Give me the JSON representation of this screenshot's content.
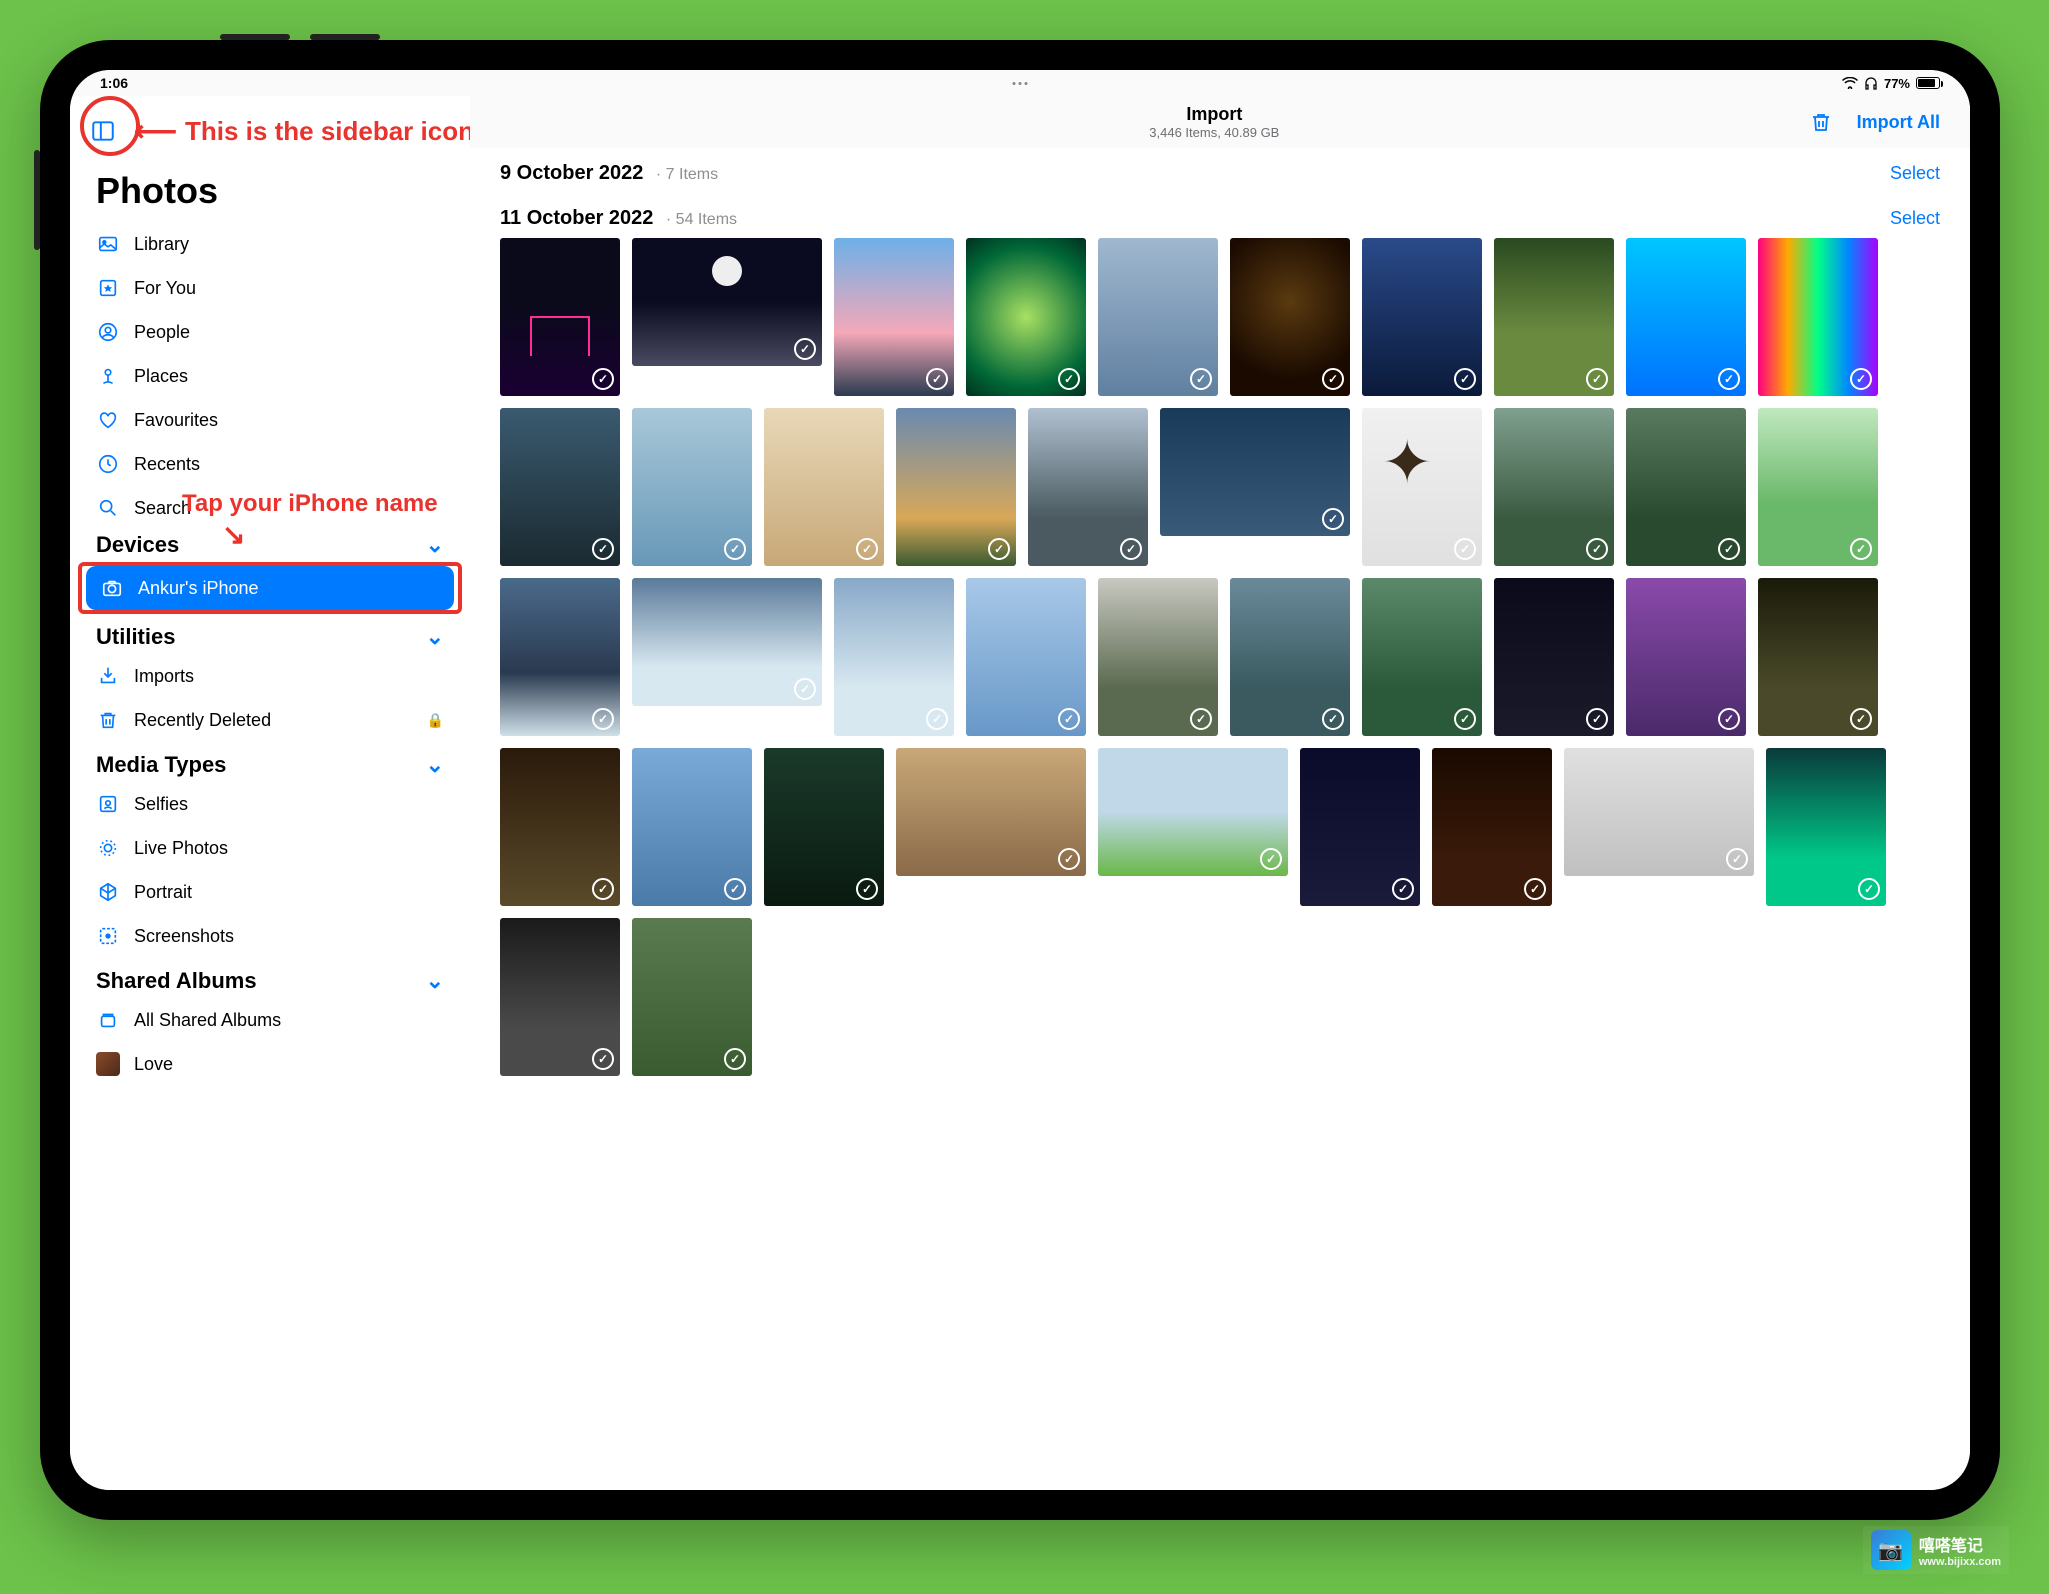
{
  "status": {
    "time": "1:06",
    "battery": "77%"
  },
  "sidebar": {
    "toggle_annotation": "This is the sidebar icon",
    "title": "Photos",
    "items": [
      {
        "icon": "library",
        "label": "Library"
      },
      {
        "icon": "foryou",
        "label": "For You"
      },
      {
        "icon": "people",
        "label": "People"
      },
      {
        "icon": "places",
        "label": "Places"
      },
      {
        "icon": "heart",
        "label": "Favourites"
      },
      {
        "icon": "clock",
        "label": "Recents"
      },
      {
        "icon": "search",
        "label": "Search"
      }
    ],
    "devices_header": "Devices",
    "iphone_annotation": "Tap your iPhone name",
    "device_item": "Ankur's iPhone",
    "utilities_header": "Utilities",
    "utilities": [
      {
        "icon": "imports",
        "label": "Imports"
      },
      {
        "icon": "trash",
        "label": "Recently Deleted",
        "locked": true
      }
    ],
    "media_header": "Media Types",
    "media": [
      {
        "icon": "selfie",
        "label": "Selfies"
      },
      {
        "icon": "live",
        "label": "Live Photos"
      },
      {
        "icon": "portrait",
        "label": "Portrait"
      },
      {
        "icon": "screenshot",
        "label": "Screenshots"
      }
    ],
    "shared_header": "Shared Albums",
    "shared": [
      {
        "icon": "shared",
        "label": "All Shared Albums"
      },
      {
        "icon": "love",
        "label": "Love"
      }
    ]
  },
  "topbar": {
    "title": "Import",
    "subtitle": "3,446 Items, 40.89 GB",
    "import_all": "Import All"
  },
  "sections": [
    {
      "date": "9 October 2022",
      "count": "7 Items",
      "select": "Select"
    },
    {
      "date": "11 October 2022",
      "count": "54 Items",
      "select": "Select"
    }
  ],
  "watermark": {
    "name": "嘻嗒笔记",
    "url": "www.bijixx.com"
  },
  "thumbs": {
    "row1": [
      {
        "o": "port",
        "bg": "linear-gradient(180deg,#0a0a1a 40%,#1a0033)",
        "accent": "#ff2d95"
      },
      {
        "o": "land",
        "bg": "linear-gradient(180deg,#0a0a20 50%,#4a4a60)",
        "moon": true
      },
      {
        "o": "port",
        "bg": "linear-gradient(180deg,#6db0e8,#f4a8b8 60%,#2a3a50)"
      },
      {
        "o": "port",
        "bg": "radial-gradient(circle at 50% 50%,#a8e063,#006837 70%,#003020)"
      },
      {
        "o": "port",
        "bg": "linear-gradient(180deg,#a0b8d0,#6080a0)"
      },
      {
        "o": "port",
        "bg": "radial-gradient(circle at 50% 40%,#5a3a10,#1a0a00 70%)"
      },
      {
        "o": "port",
        "bg": "linear-gradient(180deg,#2a4a8a,#0a1a3a)"
      }
    ],
    "row2": [
      {
        "o": "port",
        "bg": "linear-gradient(180deg,#2a4a20,#6a8a40 60%)"
      },
      {
        "o": "port",
        "bg": "linear-gradient(180deg,#00c6ff,#0072ff)"
      },
      {
        "o": "port",
        "bg": "linear-gradient(90deg,#ff0080,#ffaa00,#00ff88,#0088ff,#aa00ff)"
      },
      {
        "o": "port",
        "bg": "linear-gradient(180deg,#3a5a70,#1a2a30)"
      },
      {
        "o": "port",
        "bg": "linear-gradient(180deg,#a8c8d8,#6898b8)"
      },
      {
        "o": "port",
        "bg": "linear-gradient(180deg,#e8d8b8,#c8a878)"
      }
    ],
    "row3": [
      {
        "o": "port",
        "bg": "linear-gradient(180deg,#6a8ab0,#d8a858 70%,#3a5a30)"
      },
      {
        "o": "port",
        "bg": "linear-gradient(180deg,#b0c0d0,#4a5a60 70%)"
      },
      {
        "o": "land",
        "bg": "linear-gradient(180deg,#1a3a5a,#3a5a7a)"
      },
      {
        "o": "port",
        "bg": "linear-gradient(180deg,#f0f0f0,#e0e0e0)",
        "branch": true
      },
      {
        "o": "port",
        "bg": "linear-gradient(180deg,#80a090,#3a5a40 70%)"
      },
      {
        "o": "port",
        "bg": "linear-gradient(180deg,#5a7a60,#2a4a30 70%)"
      },
      {
        "o": "port",
        "bg": "linear-gradient(180deg,#c0e8c0,#6ab86a 60%)"
      }
    ],
    "row4": [
      {
        "o": "port",
        "bg": "linear-gradient(180deg,#4a6a8a,#2a3a50 60%,#d0e0e8)"
      },
      {
        "o": "land",
        "bg": "linear-gradient(180deg,#5a7a9a,#d8e8f0 70%)"
      },
      {
        "o": "port",
        "bg": "linear-gradient(180deg,#88a8c8,#d8e8f0 70%)"
      },
      {
        "o": "port",
        "bg": "linear-gradient(180deg,#a8c8e8,#6898c8)"
      },
      {
        "o": "port",
        "bg": "linear-gradient(180deg,#c8c8c0,#5a6a50 70%)"
      },
      {
        "o": "port",
        "bg": "linear-gradient(180deg,#6a8a9a,#3a5a60 70%)"
      },
      {
        "o": "port",
        "bg": "linear-gradient(180deg,#5a8a6a,#2a5a3a 70%)"
      }
    ],
    "row5": [
      {
        "o": "port",
        "bg": "linear-gradient(180deg,#0a0a1a,#1a1a2a)"
      },
      {
        "o": "port",
        "bg": "linear-gradient(180deg,#8a4aaa,#4a2a6a)"
      },
      {
        "o": "port",
        "bg": "linear-gradient(180deg,#1a1a0a,#4a4a2a 70%)"
      },
      {
        "o": "port",
        "bg": "linear-gradient(180deg,#2a1a0a,#5a4a2a)"
      },
      {
        "o": "port",
        "bg": "linear-gradient(180deg,#7aaad8,#4a7aa8)"
      },
      {
        "o": "port",
        "bg": "linear-gradient(180deg,#1a3a2a,#0a1a10)"
      },
      {
        "o": "land",
        "bg": "linear-gradient(180deg,#c8a878,#8a6a48)"
      }
    ],
    "row6": [
      {
        "o": "land",
        "bg": "linear-gradient(180deg,#c0d8e8 50%,#6ab848)"
      },
      {
        "o": "port",
        "bg": "linear-gradient(180deg,#0a0a2a,#1a1a3a)"
      },
      {
        "o": "port",
        "bg": "linear-gradient(180deg,#1a0a00,#3a1a0a 70%)"
      },
      {
        "o": "land",
        "bg": "linear-gradient(180deg,#e0e0e0,#c0c0c0)"
      },
      {
        "o": "port",
        "bg": "linear-gradient(180deg,#0a3a3a,#00c888 70%)"
      },
      {
        "o": "port",
        "bg": "linear-gradient(180deg,#1a1a1a,#4a4a4a 70%)"
      },
      {
        "o": "port",
        "bg": "linear-gradient(180deg,#5a7a50,#3a5a30)"
      }
    ]
  }
}
